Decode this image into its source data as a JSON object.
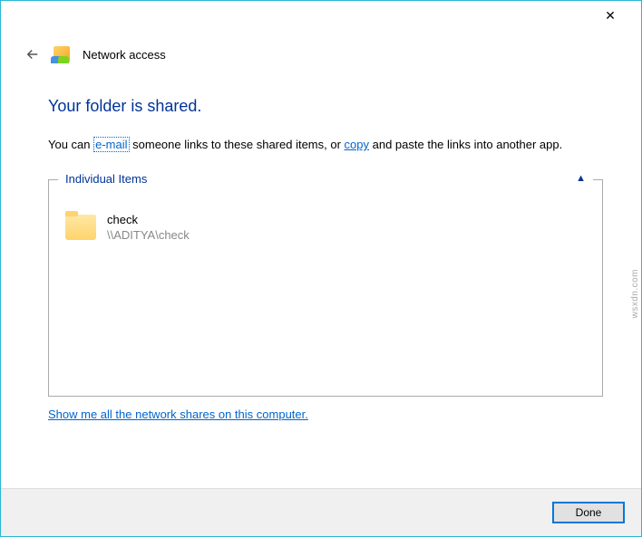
{
  "titlebar": {
    "close_label": "✕"
  },
  "header": {
    "title": "Network access"
  },
  "main": {
    "heading": "Your folder is shared.",
    "instruction_pre": "You can ",
    "email_link": "e-mail",
    "instruction_mid": " someone links to these shared items, or ",
    "copy_link": "copy",
    "instruction_post": " and paste the links into another app."
  },
  "group": {
    "legend": "Individual Items",
    "chevron": "▲",
    "items": [
      {
        "name": "check",
        "path": "\\\\ADITYA\\check"
      }
    ]
  },
  "bottom_link": "Show me all the network shares on this computer.",
  "footer": {
    "done_label": "Done"
  },
  "watermark": "wsxdn.com"
}
